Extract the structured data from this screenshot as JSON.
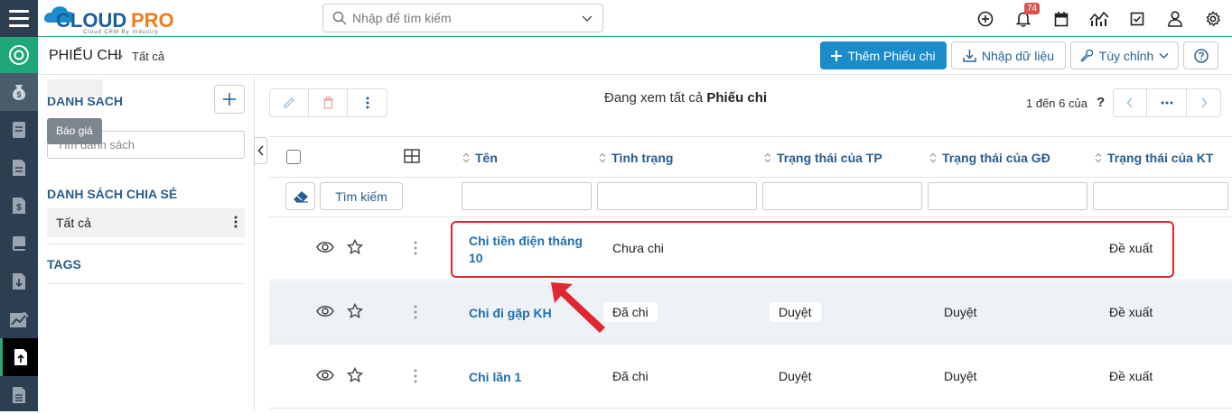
{
  "topbar": {
    "logo_text": "CLOUDPRO",
    "logo_tagline": "Cloud CRM By Industry",
    "search_placeholder": "Nhập để tìm kiếm",
    "notification_count": "74"
  },
  "sidebar": {
    "tooltip": "Báo giá"
  },
  "breadcrumb": {
    "title": "PHIẾU CHI",
    "separator": ">",
    "sub": "Tất cả"
  },
  "header_actions": {
    "add_label": "Thêm Phiếu chi",
    "import_label": "Nhập dữ liệu",
    "customize_label": "Tùy chỉnh"
  },
  "left_panel": {
    "list_heading": "DANH SÁCH",
    "list_search_placeholder": "Tìm danh sách",
    "shared_heading": "DANH SÁCH CHIA SẺ",
    "shared_item": "Tất cả",
    "tags_heading": "TAGS"
  },
  "listview": {
    "viewing_prefix": "Đang xem tất cả",
    "viewing_module": "Phiếu chi",
    "pager_text": "1 đến 6 của",
    "pager_q": "?",
    "search_button": "Tìm kiếm",
    "columns": [
      "Tên",
      "Tình trạng",
      "Trạng thái của TP",
      "Trạng thái của GĐ",
      "Trạng thái của KT"
    ],
    "rows": [
      {
        "name": "Chi tiền điện tháng 10",
        "status": "Chưa chi",
        "tp": "",
        "gd": "",
        "kt": "Đề xuất"
      },
      {
        "name": "Chi đi gặp KH",
        "status": "Đã chi",
        "tp": "Duyệt",
        "gd": "Duyệt",
        "kt": "Đề xuất"
      },
      {
        "name": "Chi lần 1",
        "status": "Đã chi",
        "tp": "Duyệt",
        "gd": "Duyệt",
        "kt": "Đề xuất"
      }
    ]
  },
  "colors": {
    "sidebar_bg": "#2c3e50",
    "accent_green": "#1fa67a",
    "primary_blue": "#1a8cc9",
    "link_blue": "#1f6fb2",
    "highlight_red": "#e0262f"
  }
}
